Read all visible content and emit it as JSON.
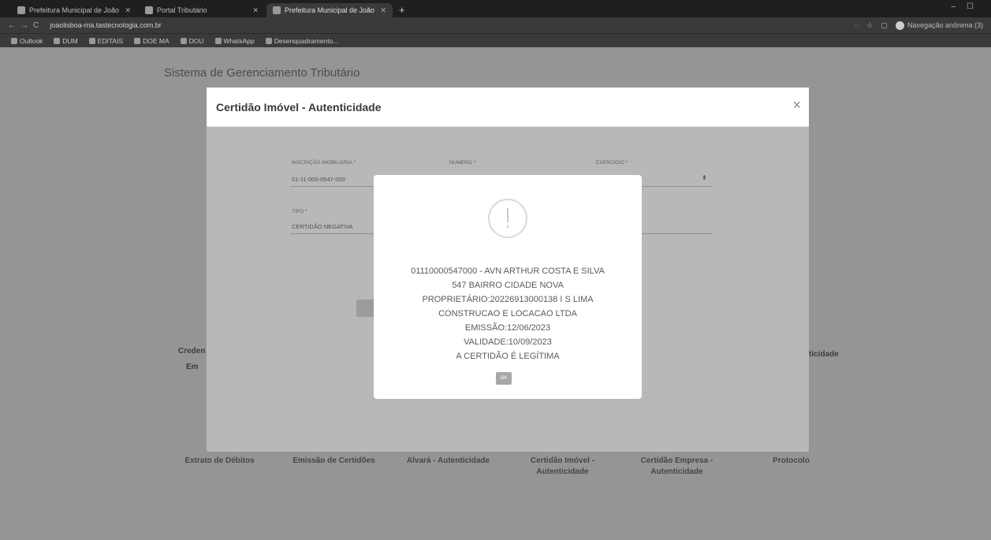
{
  "browser": {
    "tabs": [
      {
        "label": "Prefeitura Municipal de João Lisb",
        "active": false
      },
      {
        "label": "Portal Tributário",
        "active": false
      },
      {
        "label": "Prefeitura Municipal de João Lisb",
        "active": true
      }
    ],
    "new_tab": "+",
    "url": "joaolisboa-ma.tastecnologia.com.br",
    "incognito_label": "Navegação anônima (3)",
    "bookmarks": [
      "Outlook",
      "DUM",
      "EDITAIS",
      "DOE MA",
      "DOU",
      "WhatsApp",
      "Desenquadramento..."
    ]
  },
  "page": {
    "title": "Sistema de Gerenciamento Tributário",
    "left_partial_1": "Creden",
    "left_partial_2": "Em",
    "right_partial": "ticidade",
    "cards": [
      {
        "label": "Extrato de Débitos"
      },
      {
        "label": "Emissão de Certidões"
      },
      {
        "label": "Alvará - Autenticidade"
      },
      {
        "label": "Certidão Imóvel -\nAutenticidade"
      },
      {
        "label": "Certidão Empresa -\nAutenticidade"
      },
      {
        "label": "Protocolo"
      }
    ]
  },
  "modal": {
    "title": "Certidão Imóvel - Autenticidade",
    "close": "×",
    "fields": {
      "inscricao_label": "Inscrição imobiliária *",
      "inscricao_value": "01-11-000-0547-000",
      "numero_label": "Número *",
      "exercicio_label": "Exercício *",
      "tipo_label": "Tipo *",
      "tipo_value": "CERTIDÃO NEGATIVA"
    }
  },
  "alert": {
    "message": "01110000547000 - AVN ARTHUR COSTA E SILVA\n547 BAIRRO CIDADE NOVA\nPROPRIETÁRIO:20226913000138 I S LIMA\nCONSTRUCAO E LOCACAO LTDA\nEMISSÃO:12/06/2023\nVALIDADE:10/09/2023\nA CERTIDÃO É LEGÍTIMA",
    "ok_label": "OK"
  }
}
